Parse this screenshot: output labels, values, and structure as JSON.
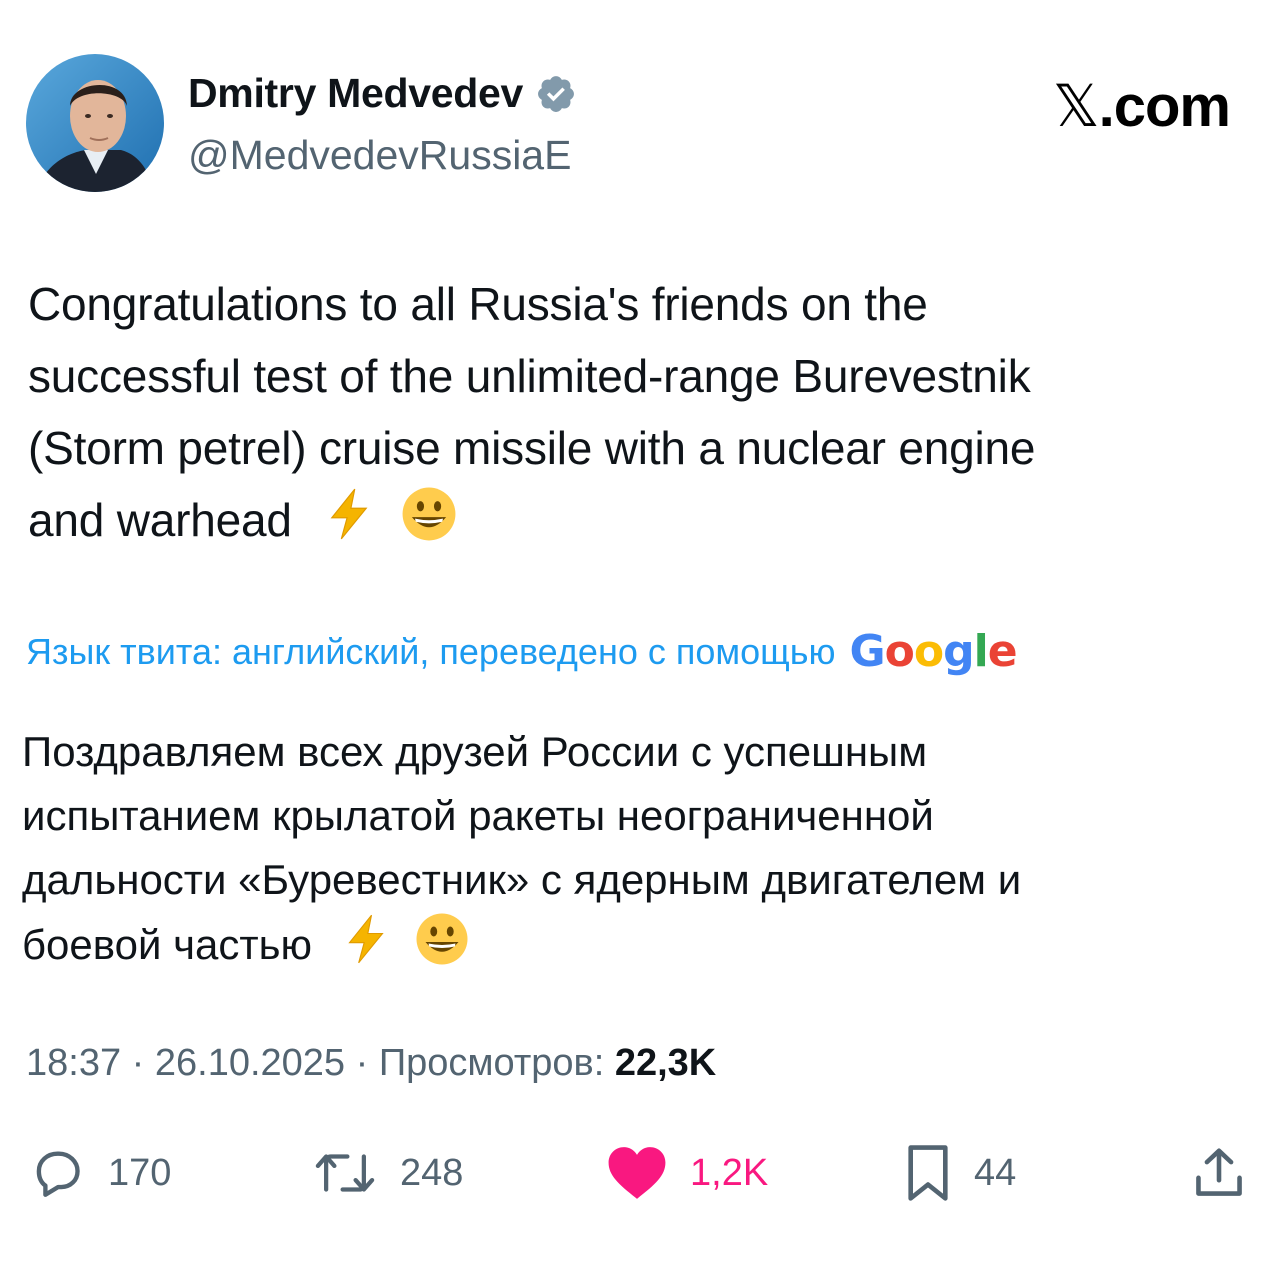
{
  "author": {
    "name": "Dmitry Medvedev",
    "handle": "@MedvedevRussiaE",
    "verified_icon": "verified-badge-icon"
  },
  "site_label": "X.com",
  "site_label_parts": {
    "x": "𝕏",
    "rest": ".com"
  },
  "tweet": {
    "lines": [
      "Congratulations to all Russia's friends on the",
      "successful test of the unlimited-range Burevestnik",
      "(Storm petrel) cruise missile with a nuclear engine",
      "and warhead"
    ],
    "emojis": [
      "lightning-emoji",
      "smiling-face-emoji"
    ]
  },
  "translation_note": {
    "text": "Язык твита: английский, переведено с помощью",
    "provider": "Google"
  },
  "translated": {
    "lines": [
      "Поздравляем всех друзей России с успешным",
      "испытанием крылатой ракеты неограниченной",
      "дальности «Буревестник» с ядерным двигателем и",
      "боевой частью"
    ]
  },
  "meta": {
    "time": "18:37",
    "separator": "·",
    "date": "26.10.2025",
    "views_label": "Просмотров:",
    "views_count": "22,3K"
  },
  "actions": {
    "replies": "170",
    "reposts": "248",
    "likes": "1,2K",
    "bookmarks": "44"
  },
  "colors": {
    "link": "#1d9bf0",
    "secondary": "#536471",
    "like": "#f91880",
    "verified": "#829aab",
    "google": [
      "#4285F4",
      "#EA4335",
      "#FBBC05",
      "#4285F4",
      "#34A853",
      "#EA4335"
    ]
  }
}
